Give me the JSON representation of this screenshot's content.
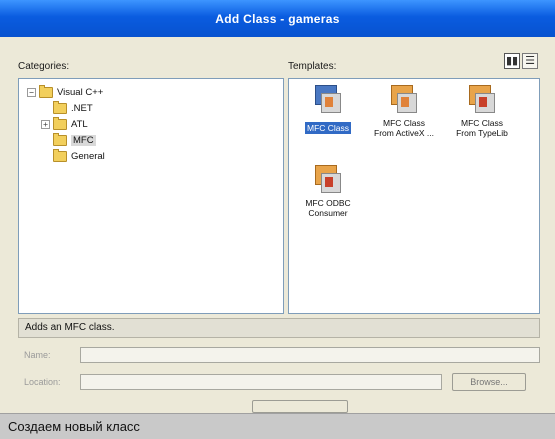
{
  "window": {
    "title": "Add Class - gameras"
  },
  "categories": {
    "label": "Categories:",
    "tree": [
      {
        "label": "Visual C++",
        "expander": "−",
        "has_expander": true
      },
      {
        "label": ".NET",
        "has_expander": false
      },
      {
        "label": "ATL",
        "expander": "+",
        "has_expander": true
      },
      {
        "label": "MFC",
        "has_expander": false,
        "selected": true
      },
      {
        "label": "General",
        "has_expander": false
      }
    ]
  },
  "templates": {
    "label": "Templates:",
    "view_large": "▮▮",
    "view_list": "☰",
    "items": [
      {
        "line1": "MFC Class",
        "line2": "",
        "icon": "mfc-class-icon",
        "selected": true
      },
      {
        "line1": "MFC Class",
        "line2": "From ActiveX ...",
        "icon": "mfc-class-from-activex-icon"
      },
      {
        "line1": "MFC Class",
        "line2": "From TypeLib",
        "icon": "mfc-class-from-typelib-icon"
      },
      {
        "line1": "MFC ODBC",
        "line2": "Consumer",
        "icon": "mfc-odbc-consumer-icon"
      }
    ]
  },
  "description": "Adds an MFC class.",
  "form": {
    "name_label": "Name:",
    "name_value": "",
    "location_label": "Location:",
    "location_value": "",
    "browse_label": "Browse..."
  },
  "caption": "Создаем новый класс"
}
